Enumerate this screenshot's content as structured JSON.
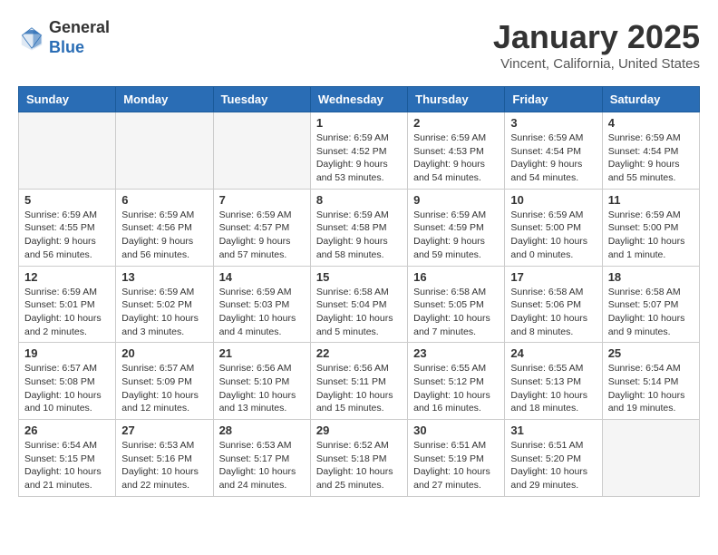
{
  "logo": {
    "general": "General",
    "blue": "Blue"
  },
  "header": {
    "title": "January 2025",
    "subtitle": "Vincent, California, United States"
  },
  "days_of_week": [
    "Sunday",
    "Monday",
    "Tuesday",
    "Wednesday",
    "Thursday",
    "Friday",
    "Saturday"
  ],
  "weeks": [
    [
      {
        "day": "",
        "info": ""
      },
      {
        "day": "",
        "info": ""
      },
      {
        "day": "",
        "info": ""
      },
      {
        "day": "1",
        "info": "Sunrise: 6:59 AM\nSunset: 4:52 PM\nDaylight: 9 hours\nand 53 minutes."
      },
      {
        "day": "2",
        "info": "Sunrise: 6:59 AM\nSunset: 4:53 PM\nDaylight: 9 hours\nand 54 minutes."
      },
      {
        "day": "3",
        "info": "Sunrise: 6:59 AM\nSunset: 4:54 PM\nDaylight: 9 hours\nand 54 minutes."
      },
      {
        "day": "4",
        "info": "Sunrise: 6:59 AM\nSunset: 4:54 PM\nDaylight: 9 hours\nand 55 minutes."
      }
    ],
    [
      {
        "day": "5",
        "info": "Sunrise: 6:59 AM\nSunset: 4:55 PM\nDaylight: 9 hours\nand 56 minutes."
      },
      {
        "day": "6",
        "info": "Sunrise: 6:59 AM\nSunset: 4:56 PM\nDaylight: 9 hours\nand 56 minutes."
      },
      {
        "day": "7",
        "info": "Sunrise: 6:59 AM\nSunset: 4:57 PM\nDaylight: 9 hours\nand 57 minutes."
      },
      {
        "day": "8",
        "info": "Sunrise: 6:59 AM\nSunset: 4:58 PM\nDaylight: 9 hours\nand 58 minutes."
      },
      {
        "day": "9",
        "info": "Sunrise: 6:59 AM\nSunset: 4:59 PM\nDaylight: 9 hours\nand 59 minutes."
      },
      {
        "day": "10",
        "info": "Sunrise: 6:59 AM\nSunset: 5:00 PM\nDaylight: 10 hours\nand 0 minutes."
      },
      {
        "day": "11",
        "info": "Sunrise: 6:59 AM\nSunset: 5:00 PM\nDaylight: 10 hours\nand 1 minute."
      }
    ],
    [
      {
        "day": "12",
        "info": "Sunrise: 6:59 AM\nSunset: 5:01 PM\nDaylight: 10 hours\nand 2 minutes."
      },
      {
        "day": "13",
        "info": "Sunrise: 6:59 AM\nSunset: 5:02 PM\nDaylight: 10 hours\nand 3 minutes."
      },
      {
        "day": "14",
        "info": "Sunrise: 6:59 AM\nSunset: 5:03 PM\nDaylight: 10 hours\nand 4 minutes."
      },
      {
        "day": "15",
        "info": "Sunrise: 6:58 AM\nSunset: 5:04 PM\nDaylight: 10 hours\nand 5 minutes."
      },
      {
        "day": "16",
        "info": "Sunrise: 6:58 AM\nSunset: 5:05 PM\nDaylight: 10 hours\nand 7 minutes."
      },
      {
        "day": "17",
        "info": "Sunrise: 6:58 AM\nSunset: 5:06 PM\nDaylight: 10 hours\nand 8 minutes."
      },
      {
        "day": "18",
        "info": "Sunrise: 6:58 AM\nSunset: 5:07 PM\nDaylight: 10 hours\nand 9 minutes."
      }
    ],
    [
      {
        "day": "19",
        "info": "Sunrise: 6:57 AM\nSunset: 5:08 PM\nDaylight: 10 hours\nand 10 minutes."
      },
      {
        "day": "20",
        "info": "Sunrise: 6:57 AM\nSunset: 5:09 PM\nDaylight: 10 hours\nand 12 minutes."
      },
      {
        "day": "21",
        "info": "Sunrise: 6:56 AM\nSunset: 5:10 PM\nDaylight: 10 hours\nand 13 minutes."
      },
      {
        "day": "22",
        "info": "Sunrise: 6:56 AM\nSunset: 5:11 PM\nDaylight: 10 hours\nand 15 minutes."
      },
      {
        "day": "23",
        "info": "Sunrise: 6:55 AM\nSunset: 5:12 PM\nDaylight: 10 hours\nand 16 minutes."
      },
      {
        "day": "24",
        "info": "Sunrise: 6:55 AM\nSunset: 5:13 PM\nDaylight: 10 hours\nand 18 minutes."
      },
      {
        "day": "25",
        "info": "Sunrise: 6:54 AM\nSunset: 5:14 PM\nDaylight: 10 hours\nand 19 minutes."
      }
    ],
    [
      {
        "day": "26",
        "info": "Sunrise: 6:54 AM\nSunset: 5:15 PM\nDaylight: 10 hours\nand 21 minutes."
      },
      {
        "day": "27",
        "info": "Sunrise: 6:53 AM\nSunset: 5:16 PM\nDaylight: 10 hours\nand 22 minutes."
      },
      {
        "day": "28",
        "info": "Sunrise: 6:53 AM\nSunset: 5:17 PM\nDaylight: 10 hours\nand 24 minutes."
      },
      {
        "day": "29",
        "info": "Sunrise: 6:52 AM\nSunset: 5:18 PM\nDaylight: 10 hours\nand 25 minutes."
      },
      {
        "day": "30",
        "info": "Sunrise: 6:51 AM\nSunset: 5:19 PM\nDaylight: 10 hours\nand 27 minutes."
      },
      {
        "day": "31",
        "info": "Sunrise: 6:51 AM\nSunset: 5:20 PM\nDaylight: 10 hours\nand 29 minutes."
      },
      {
        "day": "",
        "info": ""
      }
    ]
  ]
}
